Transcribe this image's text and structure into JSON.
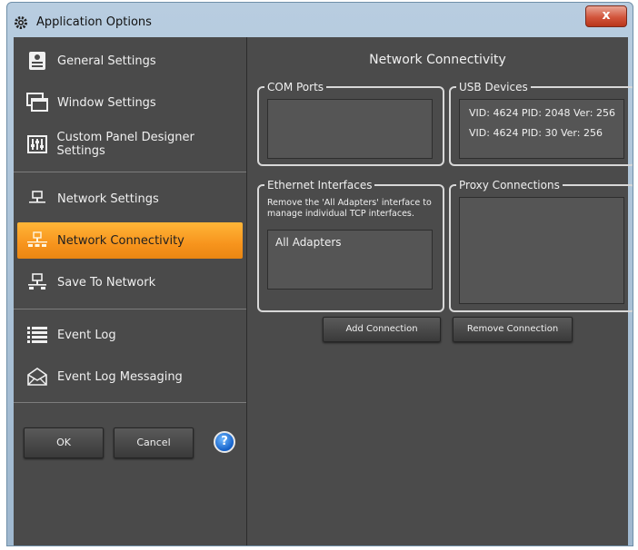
{
  "window": {
    "title": "Application Options",
    "close_label": "x"
  },
  "sidebar": {
    "items": [
      {
        "label": "General Settings",
        "icon": "general-settings-icon"
      },
      {
        "label": "Window Settings",
        "icon": "window-icon"
      },
      {
        "label": "Custom Panel Designer Settings",
        "icon": "panel-sliders-icon"
      },
      {
        "label": "Network Settings",
        "icon": "network-icon"
      },
      {
        "label": "Network Connectivity",
        "icon": "network-connectivity-icon",
        "active": true
      },
      {
        "label": "Save To Network",
        "icon": "save-network-icon"
      },
      {
        "label": "Event Log",
        "icon": "list-icon"
      },
      {
        "label": "Event Log Messaging",
        "icon": "envelope-icon"
      }
    ],
    "ok_label": "OK",
    "cancel_label": "Cancel",
    "help_label": "?"
  },
  "main": {
    "title": "Network Connectivity",
    "com_ports": {
      "label": "COM Ports",
      "items": []
    },
    "usb_devices": {
      "label": "USB Devices",
      "items": [
        "VID: 4624 PID: 2048 Ver: 256",
        "VID: 4624 PID: 30 Ver: 256"
      ]
    },
    "ethernet": {
      "label": "Ethernet Interfaces",
      "hint": "Remove the 'All Adapters' interface to manage individual TCP interfaces.",
      "items": [
        "All Adapters"
      ]
    },
    "proxy": {
      "label": "Proxy Connections",
      "items": []
    },
    "add_connection_label": "Add Connection",
    "remove_connection_label": "Remove Connection"
  },
  "colors": {
    "accent": "#f7941d",
    "panel_bg": "#4b4b4b",
    "group_border": "#d8d8d8"
  }
}
